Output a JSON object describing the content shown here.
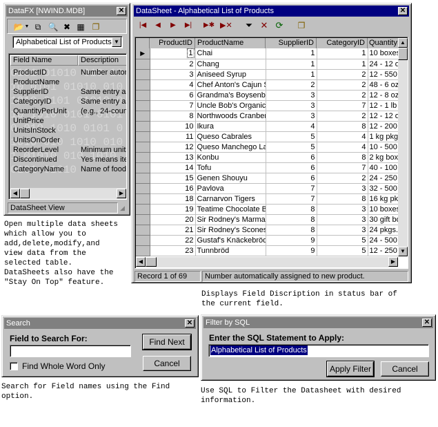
{
  "datafx": {
    "title": "DataFX [NWIND.MDB]",
    "table_select": "Alphabetical List of Products",
    "columns": [
      "Field Name",
      "Description"
    ],
    "rows": [
      [
        "ProductID",
        "Number autom"
      ],
      [
        "ProductName",
        ""
      ],
      [
        "SupplierID",
        "Same entry as"
      ],
      [
        "CategoryID",
        "Same entry as"
      ],
      [
        "QuantityPerUnit",
        "(e.g., 24-count"
      ],
      [
        "UnitPrice",
        ""
      ],
      [
        "UnitsInStock",
        ""
      ],
      [
        "UnitsOnOrder",
        ""
      ],
      [
        "ReorderLevel",
        "Minimum units"
      ],
      [
        "Discontinued",
        "Yes means iter"
      ],
      [
        "CategoryName",
        "Name of food c"
      ]
    ],
    "status": "DataSheet View"
  },
  "datasheet": {
    "title": "DataSheet - Alphabetical List of Products",
    "columns": [
      "ProductID",
      "ProductName",
      "SupplierID",
      "CategoryID",
      "QuantityP"
    ],
    "rows": [
      [
        "1",
        "Chai",
        "1",
        "1",
        "10 boxes"
      ],
      [
        "2",
        "Chang",
        "1",
        "1",
        "24 - 12 o"
      ],
      [
        "3",
        "Aniseed Syrup",
        "1",
        "2",
        "12 - 550"
      ],
      [
        "4",
        "Chef Anton's Cajun S",
        "2",
        "2",
        "48 - 6 oz"
      ],
      [
        "6",
        "Grandma's Boysenbe",
        "3",
        "2",
        "12 - 8 oz"
      ],
      [
        "7",
        "Uncle Bob's Organic",
        "3",
        "7",
        "12 - 1 lb"
      ],
      [
        "8",
        "Northwoods Cranber",
        "3",
        "2",
        "12 - 12 o"
      ],
      [
        "10",
        "Ikura",
        "4",
        "8",
        "12 - 200"
      ],
      [
        "11",
        "Queso Cabrales",
        "5",
        "4",
        "1 kg pkg"
      ],
      [
        "12",
        "Queso Manchego La",
        "5",
        "4",
        "10 - 500"
      ],
      [
        "13",
        "Konbu",
        "6",
        "8",
        "2 kg box"
      ],
      [
        "14",
        "Tofu",
        "6",
        "7",
        "40 - 100"
      ],
      [
        "15",
        "Genen Shouyu",
        "6",
        "2",
        "24 - 250"
      ],
      [
        "16",
        "Pavlova",
        "7",
        "3",
        "32 - 500"
      ],
      [
        "18",
        "Carnarvon Tigers",
        "7",
        "8",
        "16 kg pk"
      ],
      [
        "19",
        "Teatime Chocolate B",
        "8",
        "3",
        "10 boxes"
      ],
      [
        "20",
        "Sir Rodney's Marmal",
        "8",
        "3",
        "30 gift bo"
      ],
      [
        "21",
        "Sir Rodney's Scones",
        "8",
        "3",
        "24 pkgs."
      ],
      [
        "22",
        "Gustaf's Knäckebröd",
        "9",
        "5",
        "24 - 500"
      ],
      [
        "23",
        "Tunnbröd",
        "9",
        "5",
        "12 - 250"
      ]
    ],
    "record_status": "Record 1 of 69",
    "field_status": "Number automatically assigned to new product."
  },
  "search": {
    "title": "Search",
    "label": "Field to Search For:",
    "value": "",
    "checkbox_label": "Find Whole Word Only",
    "find_next": "Find Next",
    "cancel": "Cancel"
  },
  "filter": {
    "title": "Filter by SQL",
    "label": "Enter the SQL Statement to Apply:",
    "value": "Alphabetical List of Products",
    "apply": "Apply Filter",
    "cancel": "Cancel"
  },
  "notes": {
    "left": "Open multiple data sheets\nwhich allow you to\nadd,delete,modify,and\nview data from the\nselected table.\nDataSheets also have the\n\"Stay On Top\" feature.",
    "status": "Displays Field Discription in status bar of\nthe current field.",
    "search": "Search for Field names using the Find\noption.",
    "filter": "Use SQL to Filter the Datasheet with desired\ninformation."
  }
}
